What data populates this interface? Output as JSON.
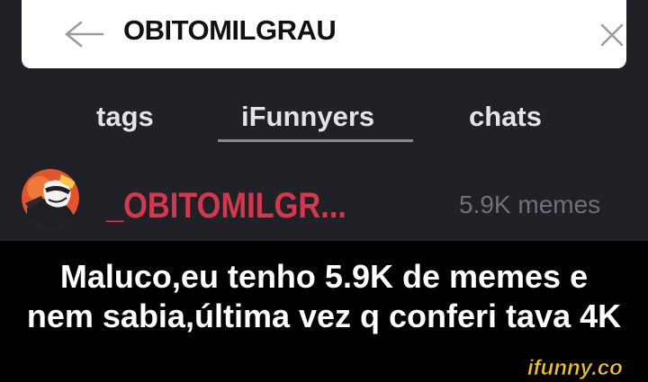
{
  "search": {
    "value": "OBITOMILGRAU"
  },
  "tabs": [
    {
      "label": "tags",
      "selected": false
    },
    {
      "label": "iFunnyers",
      "selected": true
    },
    {
      "label": "chats",
      "selected": false
    }
  ],
  "result": {
    "username": "_OBITOMILGR...",
    "meme_count": "5.9K memes"
  },
  "caption": {
    "line1": "Maluco,eu tenho 5.9K de memes e",
    "line2": "nem sabia,última vez q conferi tava 4K"
  },
  "watermark": {
    "text": "ifunny.co"
  },
  "colors": {
    "app_background": "#202126",
    "caption_background": "#000000",
    "username": "#d5374c",
    "meme_count": "#6f7078",
    "watermark": "#f3c312"
  },
  "icons": {
    "back": "back-arrow-icon",
    "clear": "close-icon",
    "avatar": "user-avatar"
  }
}
